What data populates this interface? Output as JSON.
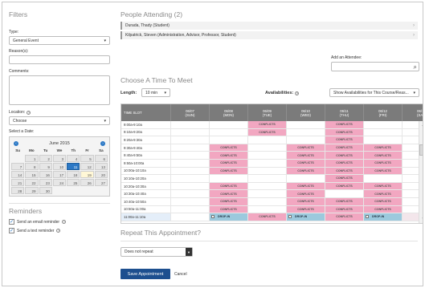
{
  "filters": {
    "title": "Filters",
    "type_label": "Type:",
    "type_value": "General Event",
    "reasons_label": "Reason(s):",
    "comments_label": "Comments:",
    "location_label": "Location:",
    "location_value": "Choose",
    "select_date_label": "Select a Date:"
  },
  "calendar": {
    "month": "June 2015",
    "dow": [
      "Su",
      "Mo",
      "Tu",
      "We",
      "Th",
      "Fr",
      "Sa"
    ],
    "weeks": [
      [
        "",
        "1",
        "2",
        "3",
        "4",
        "5",
        "6"
      ],
      [
        "7",
        "8",
        "9",
        "10",
        "11",
        "12",
        "13"
      ],
      [
        "14",
        "15",
        "16",
        "17",
        "18",
        "19",
        "20"
      ],
      [
        "21",
        "22",
        "23",
        "24",
        "25",
        "26",
        "27"
      ],
      [
        "28",
        "29",
        "30",
        "",
        "",
        "",
        ""
      ]
    ],
    "selected": "11",
    "today": "19"
  },
  "reminders": {
    "title": "Reminders",
    "email": "Send an email reminder",
    "text": "Send a text reminder"
  },
  "attending": {
    "title": "People Attending (2)",
    "people": [
      "Durada, Thady (Student)",
      "Kilpatrick, Steven (Administration, Advisor, Professor, Student)"
    ],
    "add_label": "Add an Attendee:"
  },
  "choose": {
    "title": "Choose A Time To Meet",
    "length_label": "Length:",
    "length_value": "10 min",
    "avail_label": "Availabilities:",
    "avail_value": "Show Availabilities for This Course/Reas..."
  },
  "grid": {
    "headers": [
      {
        "l1": "TIME SLOT",
        "l2": ""
      },
      {
        "l1": "06/07",
        "l2": "(SUN)"
      },
      {
        "l1": "06/08",
        "l2": "(MON)"
      },
      {
        "l1": "06/09",
        "l2": "(TUE)"
      },
      {
        "l1": "06/10",
        "l2": "(WED)"
      },
      {
        "l1": "06/11",
        "l2": "(THU)"
      },
      {
        "l1": "06/12",
        "l2": "(FRI)"
      },
      {
        "l1": "06/13",
        "l2": "(SAT)"
      }
    ],
    "conflict_label": "CONFLICTS",
    "dropin_label": "DROP-IN",
    "rows": [
      {
        "time": "9:00a-9:10a",
        "cells": [
          "",
          "",
          "c",
          "",
          "c",
          "",
          ""
        ]
      },
      {
        "time": "9:10a-9:20a",
        "cells": [
          "",
          "",
          "c",
          "",
          "c",
          "",
          ""
        ]
      },
      {
        "time": "9:20a-9:30a",
        "cells": [
          "",
          "",
          "",
          "",
          "c",
          "",
          ""
        ]
      },
      {
        "time": "9:30a-9:40a",
        "cells": [
          "",
          "c",
          "",
          "c",
          "c",
          "c",
          ""
        ]
      },
      {
        "time": "9:40a-9:50a",
        "cells": [
          "",
          "c",
          "",
          "c",
          "c",
          "c",
          ""
        ]
      },
      {
        "time": "9:50a-10:00a",
        "cells": [
          "",
          "c",
          "",
          "c",
          "c",
          "c",
          ""
        ]
      },
      {
        "time": "10:00a-10:10a",
        "cells": [
          "",
          "c",
          "",
          "c",
          "c",
          "c",
          ""
        ]
      },
      {
        "time": "10:10a-10:20a",
        "cells": [
          "",
          "",
          "",
          "",
          "c",
          "",
          ""
        ]
      },
      {
        "time": "10:20a-10:30a",
        "cells": [
          "",
          "c",
          "",
          "c",
          "c",
          "c",
          ""
        ]
      },
      {
        "time": "10:30a-10:40a",
        "cells": [
          "",
          "c",
          "",
          "c",
          "",
          "c",
          ""
        ]
      },
      {
        "time": "10:40a-10:50a",
        "cells": [
          "",
          "c",
          "",
          "c",
          "c",
          "c",
          ""
        ]
      },
      {
        "time": "10:50a-11:00a",
        "cells": [
          "",
          "c",
          "",
          "c",
          "c",
          "c",
          ""
        ]
      },
      {
        "time": "11:00a-11:10a",
        "cells": [
          "",
          "d",
          "c",
          "d",
          "c",
          "d",
          "p"
        ]
      }
    ]
  },
  "repeat": {
    "title": "Repeat This Appointment?",
    "value": "Does not repeat"
  },
  "actions": {
    "save": "Save Appointment",
    "cancel": "Cancel"
  },
  "colors": {
    "conflict": "#f2a7c1",
    "dropin": "#9cc9dd",
    "header": "#7b7b7b",
    "primary": "#1d4f8f"
  }
}
